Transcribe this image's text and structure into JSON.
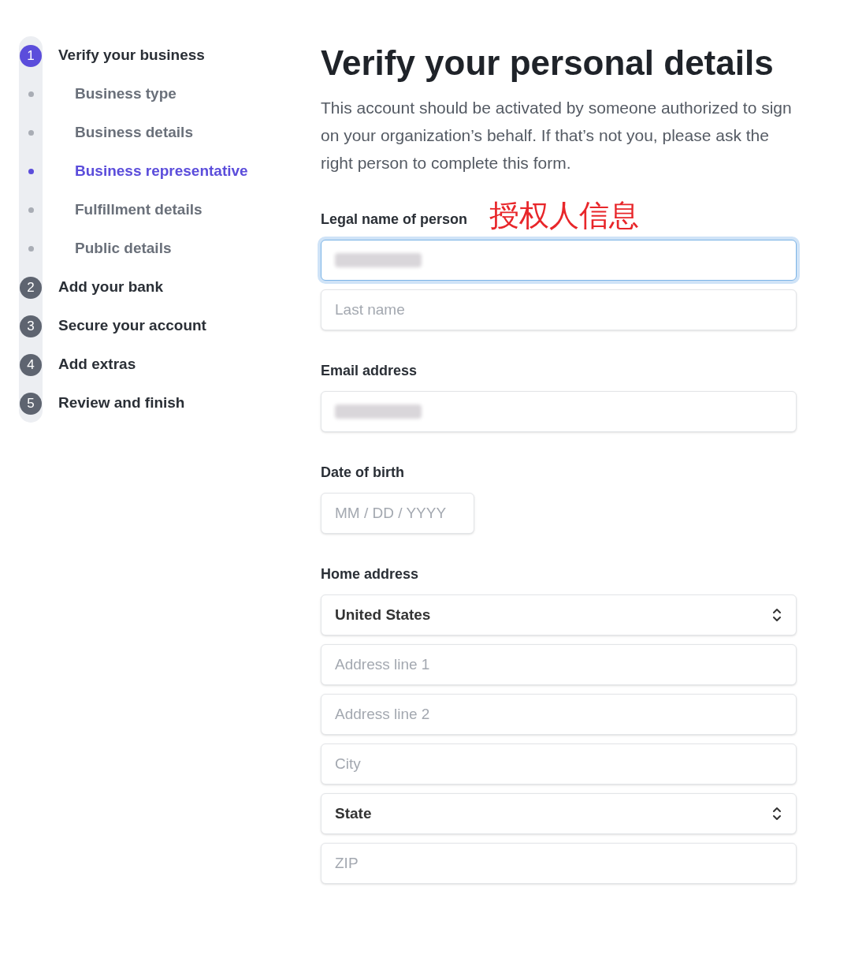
{
  "sidebar": {
    "steps": [
      {
        "number": "1",
        "label": "Verify your business",
        "selected": true,
        "substeps": [
          {
            "label": "Business type",
            "selected": false
          },
          {
            "label": "Business details",
            "selected": false
          },
          {
            "label": "Business representative",
            "selected": true
          },
          {
            "label": "Fulfillment details",
            "selected": false
          },
          {
            "label": "Public details",
            "selected": false
          }
        ]
      },
      {
        "number": "2",
        "label": "Add your bank",
        "selected": false
      },
      {
        "number": "3",
        "label": "Secure your account",
        "selected": false
      },
      {
        "number": "4",
        "label": "Add extras",
        "selected": false
      },
      {
        "number": "5",
        "label": "Review and finish",
        "selected": false
      }
    ]
  },
  "form": {
    "title": "Verify your personal details",
    "description": "This account should be activated by someone authorized to sign on your organization’s behalf. If that’s not you, please ask the right person to complete this form.",
    "sections": [
      {
        "label": "Legal name of person",
        "annotation": "授权人信息",
        "fields": [
          {
            "kind": "text",
            "redacted": true,
            "focused": true
          },
          {
            "kind": "text",
            "placeholder": "Last name",
            "focused": false
          }
        ]
      },
      {
        "label": "Email address",
        "fields": [
          {
            "kind": "text",
            "redacted": true,
            "focused": false
          }
        ]
      },
      {
        "label": "Date of birth",
        "fields": [
          {
            "kind": "date",
            "placeholder": "MM / DD / YYYY",
            "focused": false
          }
        ]
      },
      {
        "label": "Home address",
        "fields": [
          {
            "kind": "select",
            "value": "United States",
            "focused": false
          },
          {
            "kind": "text",
            "placeholder": "Address line 1",
            "focused": false
          },
          {
            "kind": "text",
            "placeholder": "Address line 2",
            "focused": false
          },
          {
            "kind": "text",
            "placeholder": "City",
            "focused": false
          },
          {
            "kind": "select",
            "value": "State",
            "focused": false
          },
          {
            "kind": "text",
            "placeholder": "ZIP",
            "focused": false
          }
        ]
      }
    ]
  }
}
